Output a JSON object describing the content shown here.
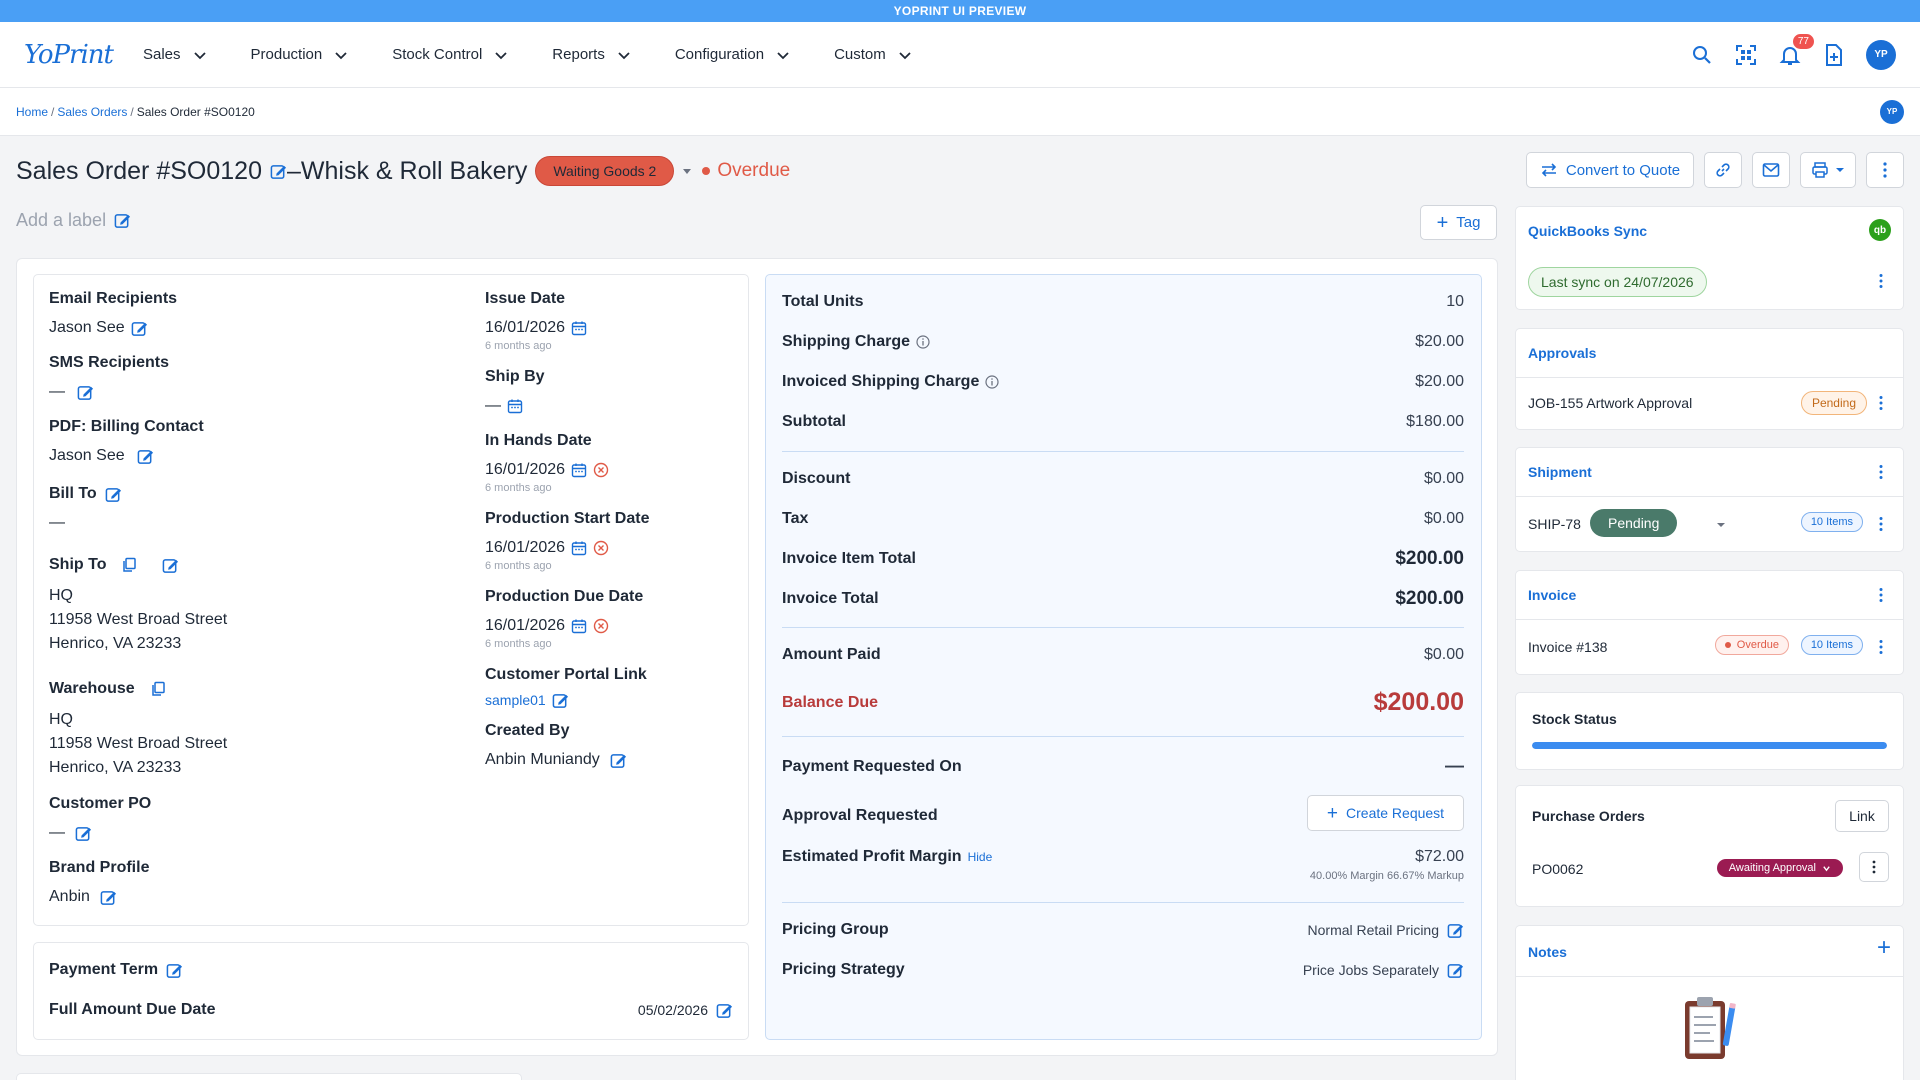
{
  "banner": "YOPRINT UI PREVIEW",
  "logo": "YoPrint",
  "nav": {
    "menu": [
      "Sales",
      "Production",
      "Stock Control",
      "Reports",
      "Configuration",
      "Custom"
    ],
    "notifications_count": "77",
    "avatar": "YP"
  },
  "breadcrumb": {
    "home": "Home",
    "sales_orders": "Sales Orders",
    "current": "Sales Order #SO0120",
    "avatar": "YP"
  },
  "header": {
    "title": "Sales Order #SO0120",
    "dash": "–",
    "customer": "Whisk & Roll Bakery",
    "status": "Waiting Goods 2",
    "overdue": "Overdue",
    "convert_label": "Convert to Quote",
    "add_label": "Add a label",
    "tag_label": "Tag"
  },
  "details": {
    "email_recipients_label": "Email Recipients",
    "email_recipients_value": "Jason See",
    "sms_recipients_label": "SMS Recipients",
    "sms_recipients_value": "—",
    "pdf_contact_label": "PDF: Billing Contact",
    "pdf_contact_value": "Jason See",
    "bill_to_label": "Bill To",
    "bill_to_value": "—",
    "ship_to_label": "Ship To",
    "ship_to_name": "HQ",
    "ship_to_line1": "11958 West Broad Street",
    "ship_to_line2": "Henrico, VA 23233",
    "warehouse_label": "Warehouse",
    "warehouse_name": "HQ",
    "warehouse_line1": "11958 West Broad Street",
    "warehouse_line2": "Henrico, VA 23233",
    "customer_po_label": "Customer PO",
    "customer_po_value": "—",
    "brand_profile_label": "Brand Profile",
    "brand_profile_value": "Anbin",
    "issue_date_label": "Issue Date",
    "issue_date_value": "16/01/2026",
    "issue_date_ago": "6 months ago",
    "ship_by_label": "Ship By",
    "ship_by_value": "—",
    "in_hands_label": "In Hands Date",
    "in_hands_value": "16/01/2026",
    "in_hands_ago": "6 months ago",
    "prod_start_label": "Production Start Date",
    "prod_start_value": "16/01/2026",
    "prod_start_ago": "6 months ago",
    "prod_due_label": "Production Due Date",
    "prod_due_value": "16/01/2026",
    "prod_due_ago": "6 months ago",
    "portal_label": "Customer Portal Link",
    "portal_value": "sample01",
    "created_by_label": "Created By",
    "created_by_value": "Anbin Muniandy"
  },
  "payment": {
    "term_label": "Payment Term",
    "due_label": "Full Amount Due Date",
    "due_value": "05/02/2026"
  },
  "summary": {
    "total_units_label": "Total Units",
    "total_units": "10",
    "shipping_label": "Shipping Charge",
    "shipping": "$20.00",
    "inv_shipping_label": "Invoiced Shipping Charge",
    "inv_shipping": "$20.00",
    "subtotal_label": "Subtotal",
    "subtotal": "$180.00",
    "discount_label": "Discount",
    "discount": "$0.00",
    "tax_label": "Tax",
    "tax": "$0.00",
    "inv_item_total_label": "Invoice Item Total",
    "inv_item_total": "$200.00",
    "inv_total_label": "Invoice Total",
    "inv_total": "$200.00",
    "paid_label": "Amount Paid",
    "paid": "$0.00",
    "balance_label": "Balance Due",
    "balance": "$200.00",
    "pay_req_label": "Payment Requested On",
    "pay_req": "—",
    "approval_req_label": "Approval Requested",
    "create_request": "Create Request",
    "margin_label": "Estimated Profit Margin",
    "margin_hide": "Hide",
    "margin_value": "$72.00",
    "margin_detail": "40.00% Margin 66.67% Markup",
    "pricing_group_label": "Pricing Group",
    "pricing_group": "Normal Retail Pricing",
    "pricing_strategy_label": "Pricing Strategy",
    "pricing_strategy": "Price Jobs Separately"
  },
  "sidebar": {
    "qb_title": "QuickBooks Sync",
    "qb_sync": "Last sync on 24/07/2026",
    "approvals_title": "Approvals",
    "approval_item": "JOB-155 Artwork Approval",
    "approval_status": "Pending",
    "shipment_title": "Shipment",
    "shipment_id": "SHIP-78",
    "shipment_status": "Pending",
    "shipment_items": "10 Items",
    "invoice_title": "Invoice",
    "invoice_id": "Invoice #138",
    "invoice_status": "Overdue",
    "invoice_items": "10 Items",
    "stock_title": "Stock Status",
    "stock_progress": 1.0,
    "po_title": "Purchase Orders",
    "po_link": "Link",
    "po_id": "PO0062",
    "po_status": "Awaiting Approval",
    "notes_title": "Notes"
  },
  "colors": {
    "accent": "#1a6fd6",
    "danger": "#e05a47",
    "balance": "#b83b3b",
    "po_status": "#9b1b52",
    "shipment_status": "#4a7a6a"
  }
}
